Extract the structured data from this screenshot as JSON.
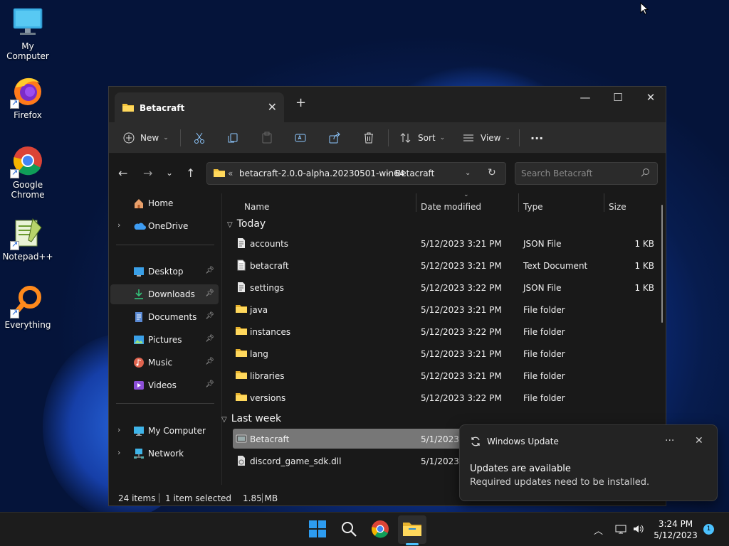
{
  "desktop": {
    "icons": [
      {
        "label": "My Computer",
        "icon": "monitor-icon"
      },
      {
        "label": "Firefox",
        "icon": "firefox-icon"
      },
      {
        "label": "Google\nChrome",
        "label_line1": "Google",
        "label_line2": "Chrome",
        "icon": "chrome-icon"
      },
      {
        "label": "Notepad++",
        "icon": "notepadpp-icon"
      },
      {
        "label": "Everything",
        "icon": "everything-icon"
      }
    ]
  },
  "explorer": {
    "tab_title": "Betacraft",
    "toolbar": {
      "new_label": "New",
      "sort_label": "Sort",
      "view_label": "View",
      "more_label": "···"
    },
    "address": {
      "overflow": "«",
      "crumb1": "betacraft-2.0.0-alpha.20230501-win64",
      "separator": "›",
      "crumb2": "Betacraft"
    },
    "search": {
      "placeholder": "Search Betacraft"
    },
    "nav": {
      "home": "Home",
      "onedrive": "OneDrive",
      "quick": [
        "Desktop",
        "Downloads",
        "Documents",
        "Pictures",
        "Music",
        "Videos"
      ],
      "my_computer": "My Computer",
      "network": "Network",
      "selected": "Downloads"
    },
    "columns": {
      "name": "Name",
      "date": "Date modified",
      "type": "Type",
      "size": "Size"
    },
    "groups": {
      "today": "Today",
      "last_week": "Last week"
    },
    "files_today": [
      {
        "name": "accounts",
        "date": "5/12/2023 3:21 PM",
        "type": "JSON File",
        "size": "1 KB",
        "icon": "json-file-icon"
      },
      {
        "name": "betacraft",
        "date": "5/12/2023 3:21 PM",
        "type": "Text Document",
        "size": "1 KB",
        "icon": "text-file-icon"
      },
      {
        "name": "settings",
        "date": "5/12/2023 3:22 PM",
        "type": "JSON File",
        "size": "1 KB",
        "icon": "json-file-icon"
      },
      {
        "name": "java",
        "date": "5/12/2023 3:21 PM",
        "type": "File folder",
        "size": "",
        "icon": "folder-icon"
      },
      {
        "name": "instances",
        "date": "5/12/2023 3:22 PM",
        "type": "File folder",
        "size": "",
        "icon": "folder-icon"
      },
      {
        "name": "lang",
        "date": "5/12/2023 3:21 PM",
        "type": "File folder",
        "size": "",
        "icon": "folder-icon"
      },
      {
        "name": "libraries",
        "date": "5/12/2023 3:21 PM",
        "type": "File folder",
        "size": "",
        "icon": "folder-icon"
      },
      {
        "name": "versions",
        "date": "5/12/2023 3:22 PM",
        "type": "File folder",
        "size": "",
        "icon": "folder-icon"
      }
    ],
    "files_last_week": [
      {
        "name": "Betacraft",
        "date": "5/1/2023 1",
        "icon": "exe-icon",
        "selected": true
      },
      {
        "name": "discord_game_sdk.dll",
        "date": "5/1/2023 1",
        "icon": "dll-icon",
        "selected": false
      }
    ],
    "status": {
      "items": "24 items",
      "selected": "1 item selected",
      "size": "1.85 MB"
    }
  },
  "toast": {
    "app": "Windows Update",
    "title": "Updates are available",
    "body": "Required updates need to be installed.",
    "more": "···",
    "close": "✕"
  },
  "taskbar": {
    "time": "3:24 PM",
    "date": "5/12/2023",
    "notification_count": "1",
    "tray_chevron": "^"
  },
  "colors": {
    "accent": "#4cc2ff",
    "folder": "#f3c33c",
    "window_bg": "#191919"
  }
}
